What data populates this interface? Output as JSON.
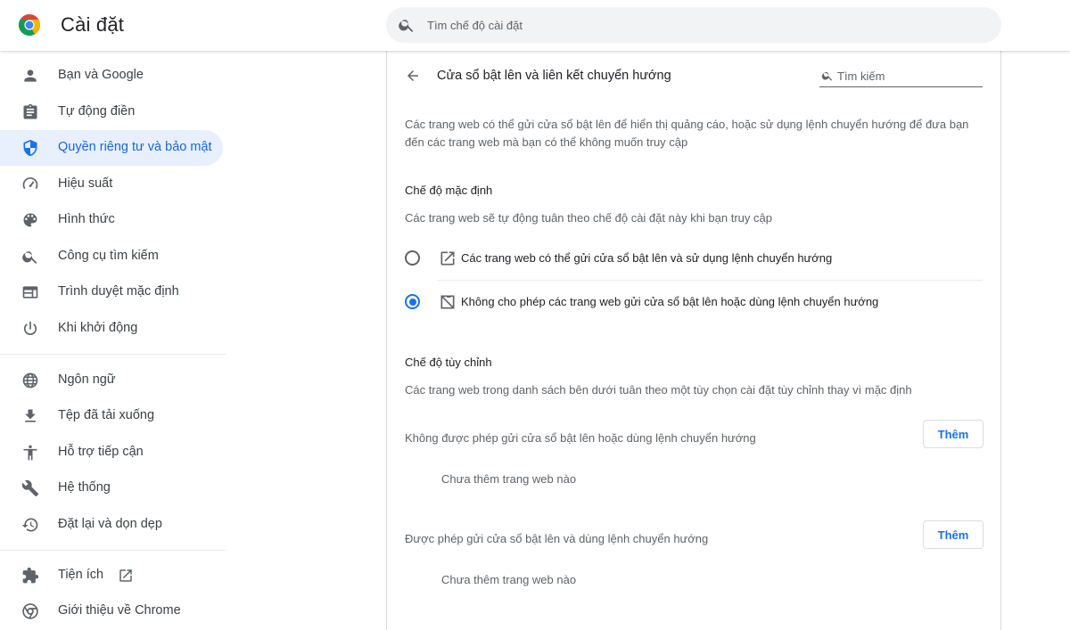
{
  "header": {
    "title": "Cài đặt",
    "search_placeholder": "Tìm chế độ cài đặt"
  },
  "sidebar": {
    "items": [
      {
        "label": "Bạn và Google",
        "icon": "person-icon"
      },
      {
        "label": "Tự động điền",
        "icon": "clipboard-icon"
      },
      {
        "label": "Quyền riêng tư và bảo mật",
        "icon": "shield-icon",
        "active": true
      },
      {
        "label": "Hiệu suất",
        "icon": "speedometer-icon"
      },
      {
        "label": "Hình thức",
        "icon": "palette-icon"
      },
      {
        "label": "Công cụ tìm kiếm",
        "icon": "search-icon"
      },
      {
        "label": "Trình duyệt mặc định",
        "icon": "browser-window-icon"
      },
      {
        "label": "Khi khởi động",
        "icon": "power-icon"
      },
      {
        "label": "Ngôn ngữ",
        "icon": "globe-icon"
      },
      {
        "label": "Tệp đã tải xuống",
        "icon": "download-icon"
      },
      {
        "label": "Hỗ trợ tiếp cận",
        "icon": "accessibility-icon"
      },
      {
        "label": "Hệ thống",
        "icon": "wrench-icon"
      },
      {
        "label": "Đặt lại và dọn dẹp",
        "icon": "restore-icon"
      },
      {
        "label": "Tiện ích",
        "icon": "puzzle-icon"
      },
      {
        "label": "Giới thiệu về Chrome",
        "icon": "chrome-icon"
      }
    ]
  },
  "page": {
    "title": "Cửa sổ bật lên và liên kết chuyển hướng",
    "search_placeholder": "Tìm kiếm",
    "intro": "Các trang web có thể gửi cửa sổ bật lên để hiển thị quảng cáo, hoặc sử dụng lệnh chuyển hướng để đưa bạn đến các trang web mà bạn có thể không muốn truy cập",
    "default_section": {
      "title": "Chế độ mặc định",
      "description": "Các trang web sẽ tự động tuân theo chế độ cài đặt này khi bạn truy cập",
      "options": [
        {
          "label": "Các trang web có thể gửi cửa sổ bật lên và sử dụng lệnh chuyển hướng",
          "checked": false
        },
        {
          "label": "Không cho phép các trang web gửi cửa sổ bật lên hoặc dùng lệnh chuyển hướng",
          "checked": true
        }
      ]
    },
    "custom_section": {
      "title": "Chế độ tùy chỉnh",
      "description": "Các trang web trong danh sách bên dưới tuân theo một tùy chọn cài đặt tùy chỉnh thay vì mặc định",
      "lists": [
        {
          "label": "Không được phép gửi cửa sổ bật lên hoặc dùng lệnh chuyển hướng",
          "button": "Thêm",
          "empty": "Chưa thêm trang web nào"
        },
        {
          "label": "Được phép gửi cửa sổ bật lên và dùng lệnh chuyển hướng",
          "button": "Thêm",
          "empty": "Chưa thêm trang web nào"
        }
      ]
    }
  },
  "colors": {
    "accent": "#1a73e8",
    "active_bg": "#e8f0fe",
    "active_text": "#1967d2",
    "icon_gray": "#5f6368"
  }
}
